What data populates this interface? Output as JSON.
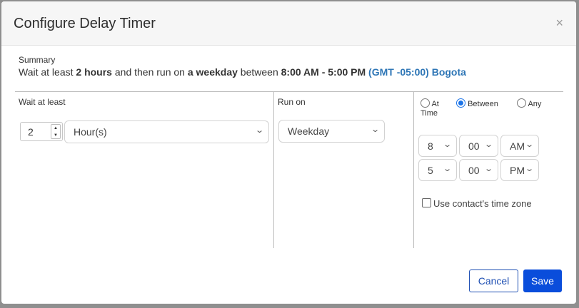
{
  "dialog": {
    "title": "Configure Delay Timer",
    "close_glyph": "×"
  },
  "summary": {
    "label": "Summary",
    "part1": "Wait at least ",
    "duration": "2 hours",
    "part2": " and then run on ",
    "day": "a weekday",
    "part3": " between ",
    "window": "8:00 AM - 5:00 PM",
    "timezone": "(GMT -05:00) Bogota"
  },
  "wait": {
    "label": "Wait at least",
    "amount": "2",
    "unit": "Hour(s)"
  },
  "run_on": {
    "label": "Run on",
    "value": "Weekday"
  },
  "time": {
    "options": [
      {
        "line1": "At",
        "line2": "Time",
        "checked": false
      },
      {
        "label": "Between",
        "checked": true
      },
      {
        "label": "Any",
        "checked": false
      }
    ],
    "start": {
      "hour": "8",
      "minute": "00",
      "ampm": "AM"
    },
    "end": {
      "hour": "5",
      "minute": "00",
      "ampm": "PM"
    },
    "contact_tz_label": "Use contact's time zone",
    "contact_tz_checked": false
  },
  "footer": {
    "cancel_label": "Cancel",
    "save_label": "Save"
  },
  "colors": {
    "accent": "#0a4ddb",
    "link": "#2e76b6",
    "radio_selected": "#1a73e8"
  }
}
